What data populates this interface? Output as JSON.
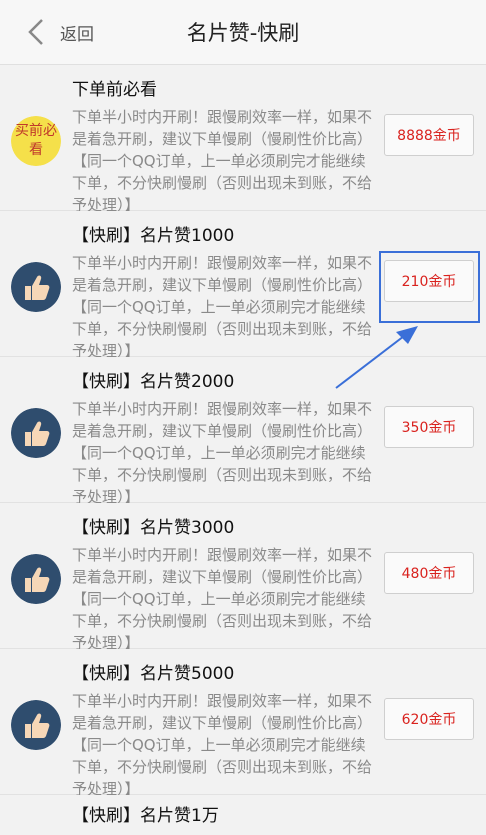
{
  "header": {
    "back_label": "返回",
    "title": "名片赞-快刷"
  },
  "notice": {
    "icon_text": "买前必看",
    "title": "下单前必看",
    "desc": "下单半小时内开刷！跟慢刷效率一样，如果不是着急开刷，建议下单慢刷（慢刷性价比高）【同一个QQ订单，上一单必须刷完才能继续下单，不分快刷慢刷（否则出现未到账，不给予处理）】",
    "price": "8888金币"
  },
  "items": [
    {
      "title": "【快刷】名片赞1000",
      "desc": "下单半小时内开刷！跟慢刷效率一样，如果不是着急开刷，建议下单慢刷（慢刷性价比高）【同一个QQ订单，上一单必须刷完才能继续下单，不分快刷慢刷（否则出现未到账，不给予处理）】",
      "price": "210金币"
    },
    {
      "title": "【快刷】名片赞2000",
      "desc": "下单半小时内开刷！跟慢刷效率一样，如果不是着急开刷，建议下单慢刷（慢刷性价比高）【同一个QQ订单，上一单必须刷完才能继续下单，不分快刷慢刷（否则出现未到账，不给予处理）】",
      "price": "350金币"
    },
    {
      "title": "【快刷】名片赞3000",
      "desc": "下单半小时内开刷！跟慢刷效率一样，如果不是着急开刷，建议下单慢刷（慢刷性价比高）【同一个QQ订单，上一单必须刷完才能继续下单，不分快刷慢刷（否则出现未到账，不给予处理）】",
      "price": "480金币"
    },
    {
      "title": "【快刷】名片赞5000",
      "desc": "下单半小时内开刷！跟慢刷效率一样，如果不是着急开刷，建议下单慢刷（慢刷性价比高）【同一个QQ订单，上一单必须刷完才能继续下单，不分快刷慢刷（否则出现未到账，不给予处理）】",
      "price": "620金币"
    },
    {
      "title": "【快刷】名片赞1万"
    }
  ],
  "colors": {
    "price_text": "#d9221e",
    "highlight": "#3a6fd8",
    "icon_bg": "#2f4d6e",
    "notice_icon_bg": "#f5e04a"
  },
  "icons": {
    "back": "chevron-left-icon",
    "item": "thumbs-up-icon",
    "notice": "buy-first-read-icon"
  }
}
